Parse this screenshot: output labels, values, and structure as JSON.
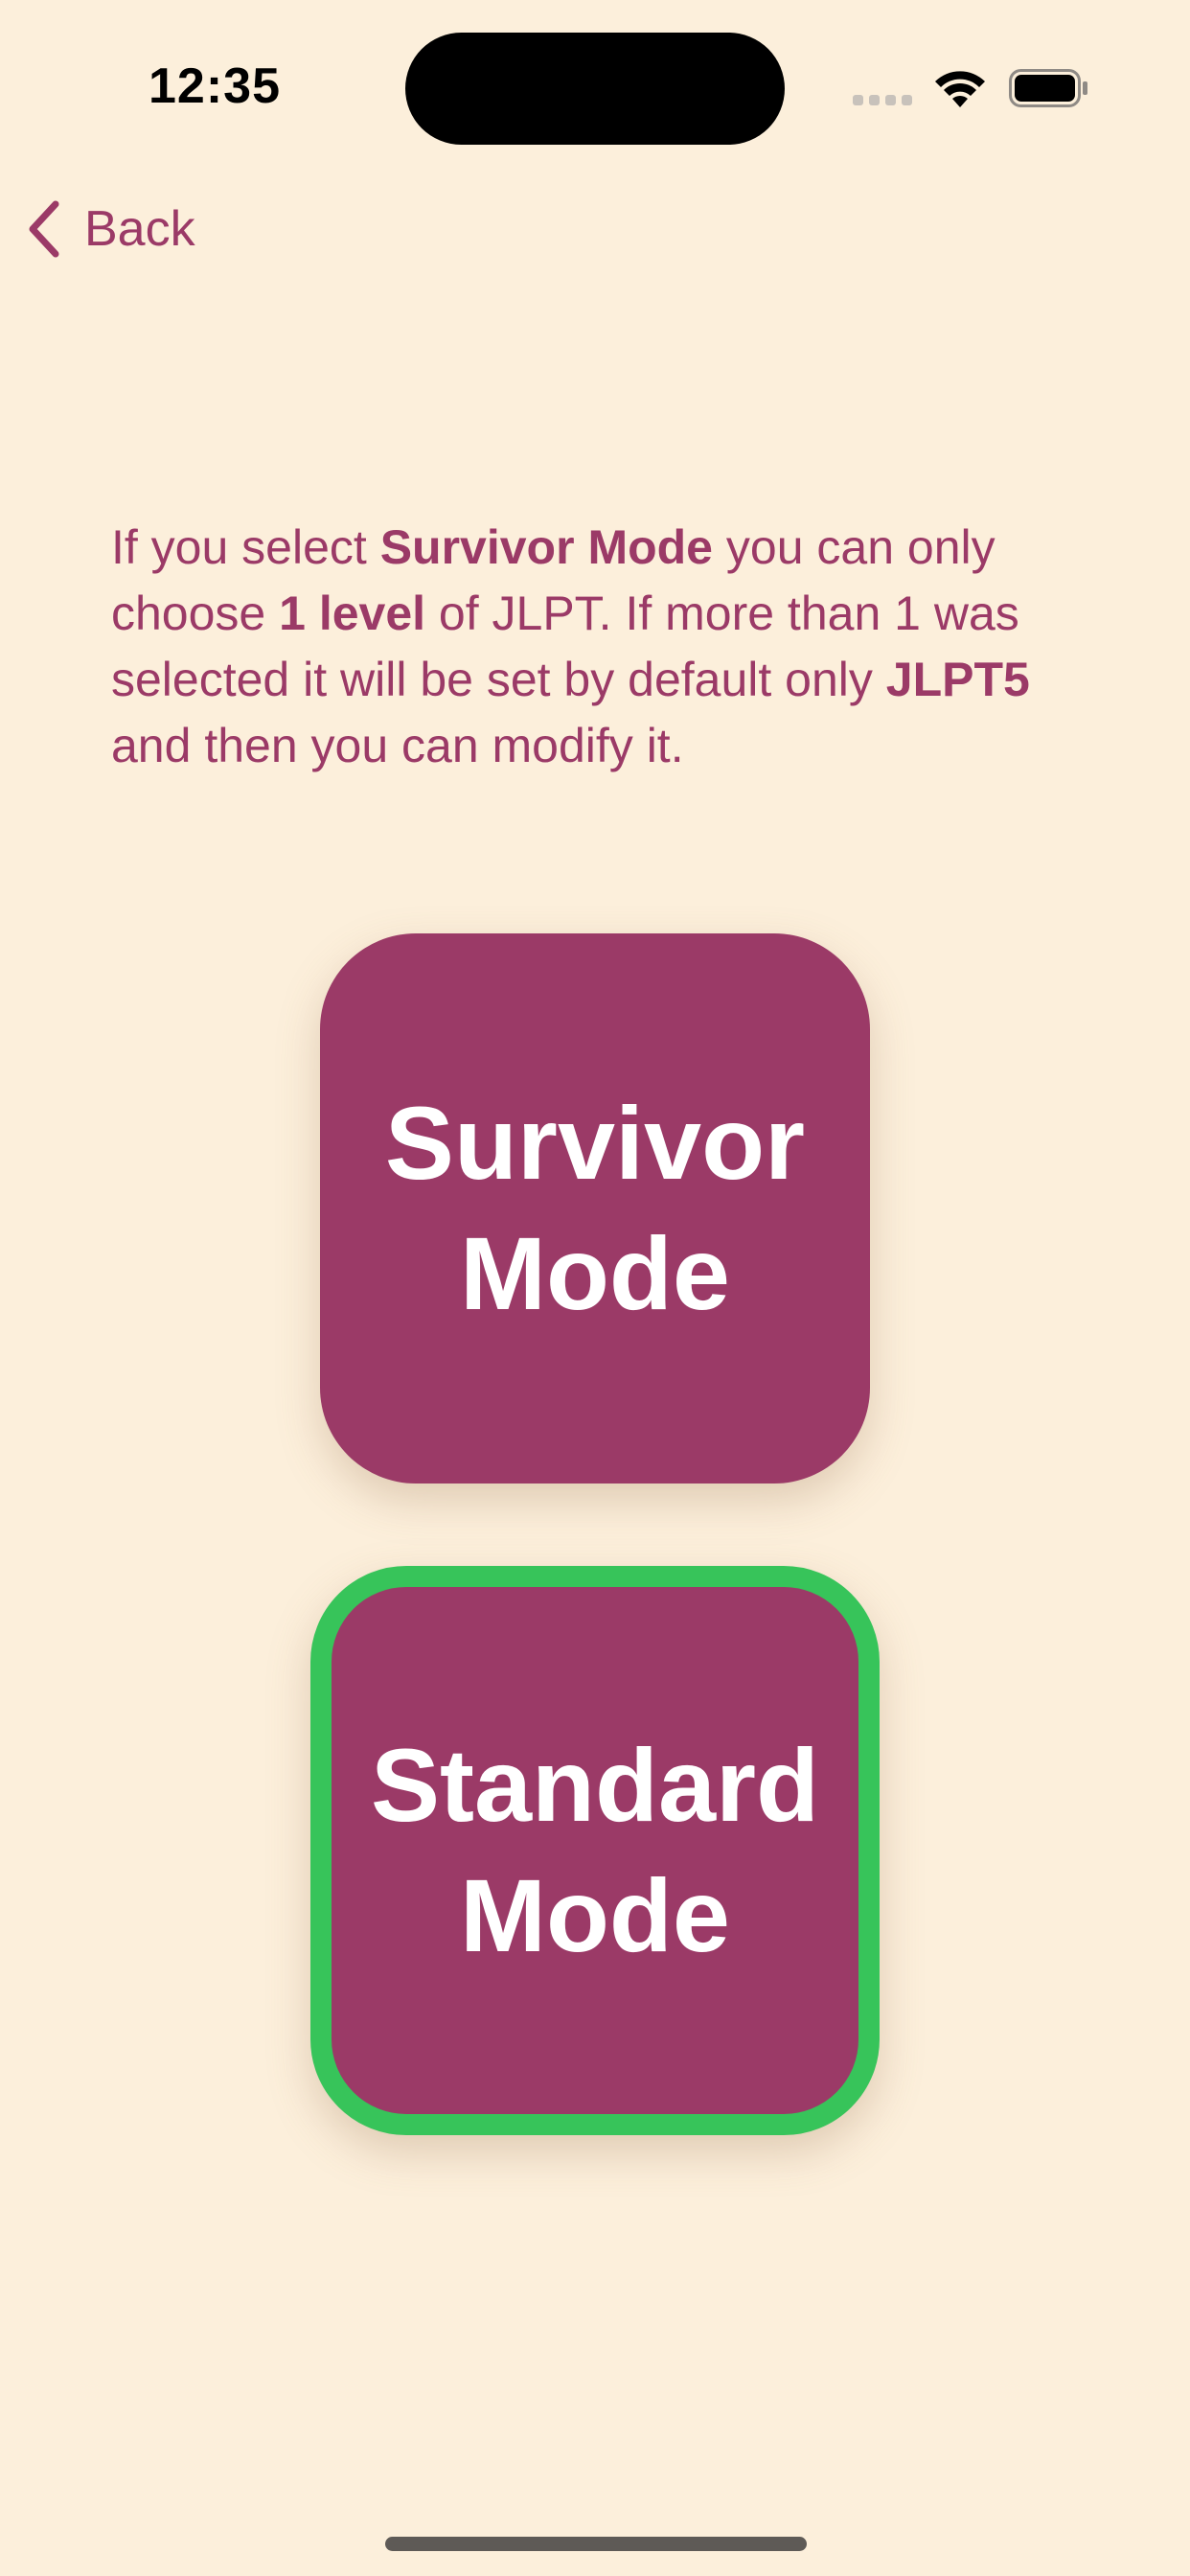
{
  "status_bar": {
    "time": "12:35"
  },
  "nav": {
    "back_label": "Back"
  },
  "info": {
    "t1": "If you select ",
    "b1": "Survivor Mode",
    "t2": " you can only choose ",
    "b2": "1 level",
    "t3": " of JLPT. If more than 1 was selected it will be set by default only ",
    "b3": "JLPT5",
    "t4": " and then you can modify it."
  },
  "modes": {
    "survivor": {
      "line1": "Survivor",
      "line2": "Mode",
      "selected": false
    },
    "standard": {
      "line1": "Standard",
      "line2": "Mode",
      "selected": true
    }
  },
  "colors": {
    "background": "#fcefdb",
    "accent": "#9b3a67",
    "selected_border": "#37c45a",
    "button_text": "#ffffff"
  }
}
